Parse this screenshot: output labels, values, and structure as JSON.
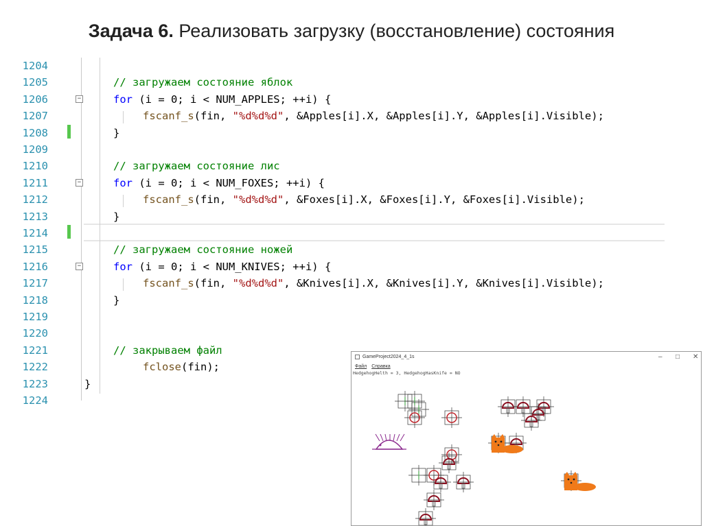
{
  "slide": {
    "title_bold": "Задача 6.",
    "title_rest": " Реализовать загрузку (восстановление) состояния"
  },
  "editor": {
    "lines": [
      {
        "num": "1204"
      },
      {
        "num": "1205",
        "comment": "// загружаем состояние яблок"
      },
      {
        "num": "1206",
        "kw": "for",
        "rest": " (i = 0; i < NUM_APPLES; ++i) {"
      },
      {
        "num": "1207",
        "fn": "fscanf_s",
        "pre": "(fin, ",
        "str": "\"%d%d%d\"",
        "post": ", &Apples[i].X, &Apples[i].Y, &Apples[i].Visible);"
      },
      {
        "num": "1208",
        "brace": "}"
      },
      {
        "num": "1209"
      },
      {
        "num": "1210",
        "comment": "// загружаем состояние лис"
      },
      {
        "num": "1211",
        "kw": "for",
        "rest": " (i = 0; i < NUM_FOXES; ++i) {"
      },
      {
        "num": "1212",
        "fn": "fscanf_s",
        "pre": "(fin, ",
        "str": "\"%d%d%d\"",
        "post": ", &Foxes[i].X, &Foxes[i].Y, &Foxes[i].Visible);"
      },
      {
        "num": "1213",
        "brace": "}"
      },
      {
        "num": "1214"
      },
      {
        "num": "1215",
        "comment": "// загружаем состояние ножей"
      },
      {
        "num": "1216",
        "kw": "for",
        "rest": " (i = 0; i < NUM_KNIVES; ++i) {"
      },
      {
        "num": "1217",
        "fn": "fscanf_s",
        "pre": "(fin, ",
        "str": "\"%d%d%d\"",
        "post": ", &Knives[i].X, &Knives[i].Y, &Knives[i].Visible);"
      },
      {
        "num": "1218",
        "brace": "}"
      },
      {
        "num": "1219"
      },
      {
        "num": "1220"
      },
      {
        "num": "1221",
        "comment": "// закрываем файл"
      },
      {
        "num": "1222",
        "fn": "fclose",
        "pre": "(fin);"
      },
      {
        "num": "1223",
        "brace": "}"
      },
      {
        "num": "1224"
      }
    ]
  },
  "game_window": {
    "title": "GameProject2024_4_1s",
    "minimize": "–",
    "maximize": "□",
    "close": "✕",
    "menu": [
      "Файл",
      "Справка"
    ],
    "status": "HedgehogHelth = 3, HedgehogHasKnife = NO",
    "colors": {
      "apple": "#c0262c",
      "knife": "#8a1020",
      "fox": "#f07a1a",
      "hedgehog": "#8b2a8e",
      "guide": "#333333"
    }
  }
}
